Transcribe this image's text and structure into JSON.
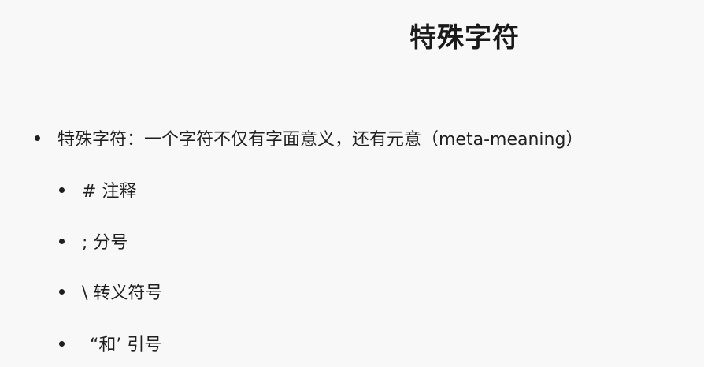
{
  "slide": {
    "title": "特殊字符",
    "main_bullet": "特殊字符：一个字符不仅有字面意义，还有元意（meta-meaning）",
    "sub_bullets": [
      "# 注释",
      "; 分号",
      "\\ 转义符号",
      "“和’ 引号"
    ]
  }
}
